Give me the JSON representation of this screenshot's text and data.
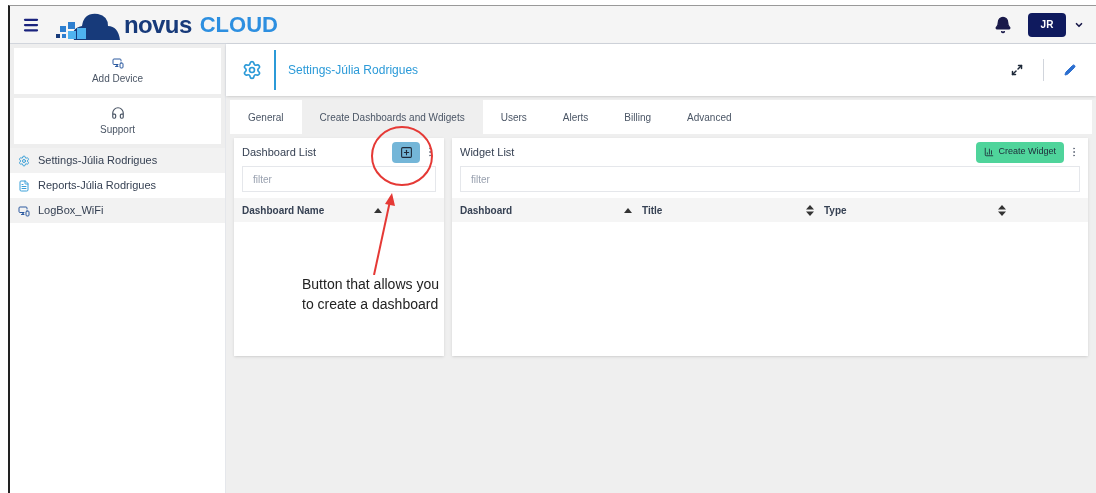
{
  "header": {
    "logo": {
      "word_1": "novus",
      "word_2": "CLOUD"
    },
    "avatar": "JR"
  },
  "sidebar": {
    "actions": [
      {
        "label": "Add Device",
        "kind": "device"
      },
      {
        "label": "Support",
        "kind": "support"
      }
    ],
    "items": [
      {
        "label": "Settings-Júlia Rodrigues",
        "kind": "settings"
      },
      {
        "label": "Reports-Júlia Rodrigues",
        "kind": "reports"
      },
      {
        "label": "LogBox_WiFi",
        "kind": "device"
      }
    ]
  },
  "page": {
    "title": "Settings-Júlia Rodrigues"
  },
  "tabs": [
    {
      "label": "General",
      "selected": false
    },
    {
      "label": "Create Dashboards and Wdigets",
      "selected": true
    },
    {
      "label": "Users",
      "selected": false
    },
    {
      "label": "Alerts",
      "selected": false
    },
    {
      "label": "Billing",
      "selected": false
    },
    {
      "label": "Advanced",
      "selected": false
    }
  ],
  "dashboard_list": {
    "title": "Dashboard List",
    "filter_placeholder": "filter",
    "columns": [
      {
        "label": "Dashboard Name",
        "sorted": true
      }
    ]
  },
  "widget_list": {
    "title": "Widget List",
    "button": "Create Widget",
    "filter_placeholder": "filter",
    "columns": [
      {
        "label": "Dashboard",
        "sorted": true
      },
      {
        "label": "Title",
        "sorted": false
      },
      {
        "label": "Type",
        "sorted": false
      }
    ]
  },
  "annotation": {
    "text": "Button that allows you to create a dashboard"
  }
}
